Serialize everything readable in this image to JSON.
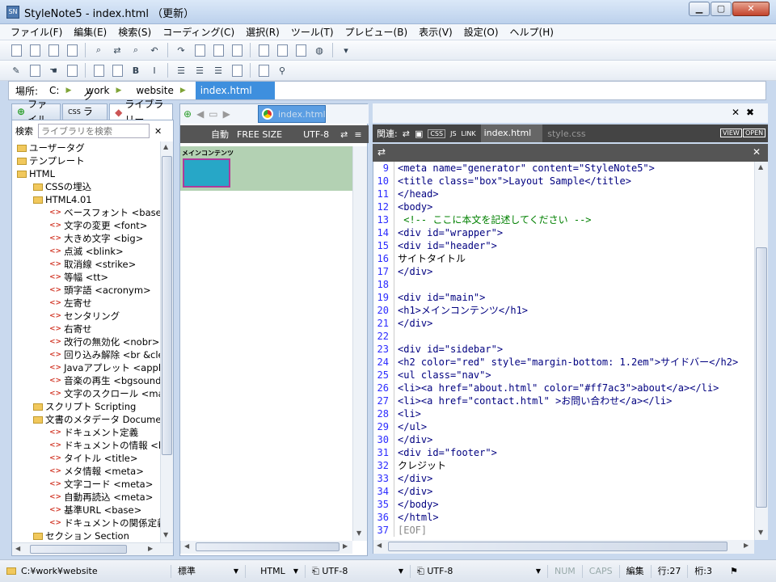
{
  "window": {
    "title": "StyleNote5 - index.html  （更新）"
  },
  "menu": [
    "ファイル(F)",
    "編集(E)",
    "検索(S)",
    "コーディング(C)",
    "選択(R)",
    "ツール(T)",
    "プレビュー(B)",
    "表示(V)",
    "設定(O)",
    "ヘルプ(H)"
  ],
  "toolbar1": [
    "new-file-icon",
    "open-file-icon",
    "save-icon",
    "save-all-icon",
    "find-icon",
    "replace-icon",
    "find-next-icon",
    "undo-icon",
    "redo-icon",
    "cut-icon",
    "copy-icon",
    "paste-icon",
    "color-palette-icon",
    "page-icon",
    "print-icon",
    "browser-icon",
    "browser-select-icon"
  ],
  "toolbar2": [
    "pencil-icon",
    "validate-icon",
    "hand-icon",
    "tag-icon",
    "html-icon",
    "css-icon",
    "bold-icon",
    "italic-icon",
    "align-left-icon",
    "align-center-icon",
    "align-right-icon",
    "image-icon",
    "table-icon",
    "link-icon"
  ],
  "path": {
    "label": "場所:",
    "crumbs": [
      "C:",
      "work",
      "website"
    ],
    "active": "index.html"
  },
  "left_tabs": [
    "ファイル",
    "クラス",
    "ライブラリー"
  ],
  "left_tab_prefix": {
    "class": "CSS"
  },
  "search": {
    "label": "検索",
    "placeholder": "ライブラリを検索"
  },
  "tree": [
    {
      "label": "ユーザータグ",
      "level": 0,
      "type": "folder"
    },
    {
      "label": "テンプレート",
      "level": 0,
      "type": "folder"
    },
    {
      "label": "HTML",
      "level": 0,
      "type": "folder"
    },
    {
      "label": "CSSの埋込",
      "level": 1,
      "type": "folder"
    },
    {
      "label": "HTML4.01",
      "level": 1,
      "type": "folder"
    },
    {
      "label": "ベースフォント <basefont>",
      "level": 2,
      "type": "tag"
    },
    {
      "label": "文字の変更 <font>",
      "level": 2,
      "type": "tag"
    },
    {
      "label": "大きめ文字 <big>",
      "level": 2,
      "type": "tag"
    },
    {
      "label": "点滅 <blink>",
      "level": 2,
      "type": "tag"
    },
    {
      "label": "取消線 <strike>",
      "level": 2,
      "type": "tag"
    },
    {
      "label": "等幅 <tt>",
      "level": 2,
      "type": "tag"
    },
    {
      "label": "頭字語 <acronym>",
      "level": 2,
      "type": "tag"
    },
    {
      "label": "左寄せ",
      "level": 2,
      "type": "tag"
    },
    {
      "label": "センタリング",
      "level": 2,
      "type": "tag"
    },
    {
      "label": "右寄せ",
      "level": 2,
      "type": "tag"
    },
    {
      "label": "改行の無効化 <nobr>",
      "level": 2,
      "type": "tag"
    },
    {
      "label": "回り込み解除 <br &clea",
      "level": 2,
      "type": "tag"
    },
    {
      "label": "Javaアプレット <applet>",
      "level": 2,
      "type": "tag"
    },
    {
      "label": "音楽の再生 <bgsound>",
      "level": 2,
      "type": "tag"
    },
    {
      "label": "文字のスクロール <marqu",
      "level": 2,
      "type": "tag"
    },
    {
      "label": "スクリプト Scripting",
      "level": 1,
      "type": "folder"
    },
    {
      "label": "文書のメタデータ Document",
      "level": 1,
      "type": "folder"
    },
    {
      "label": "ドキュメント定義",
      "level": 2,
      "type": "tag"
    },
    {
      "label": "ドキュメントの情報 <head",
      "level": 2,
      "type": "tag"
    },
    {
      "label": "タイトル <title>",
      "level": 2,
      "type": "tag"
    },
    {
      "label": "メタ情報 <meta>",
      "level": 2,
      "type": "tag"
    },
    {
      "label": "文字コード <meta>",
      "level": 2,
      "type": "tag"
    },
    {
      "label": "自動再読込 <meta>",
      "level": 2,
      "type": "tag"
    },
    {
      "label": "基準URL <base>",
      "level": 2,
      "type": "tag"
    },
    {
      "label": "ドキュメントの関係定義 <",
      "level": 2,
      "type": "tag"
    },
    {
      "label": "セクション Section",
      "level": 1,
      "type": "folder"
    }
  ],
  "tag_marker": "<>",
  "preview": {
    "tab": "index.html",
    "auto": "自動",
    "size": "FREE SIZE",
    "encoding": "UTF-8",
    "heading": "メインコンテンツ"
  },
  "editor_bar": {
    "related": "関連:",
    "tags": [
      "CSS",
      "JS",
      "LINK"
    ],
    "active": "index.html",
    "other": "style.css",
    "view": "VIEW",
    "open": "OPEN"
  },
  "code": [
    {
      "n": "9",
      "t": "<meta name=\"generator\" content=\"StyleNote5\">"
    },
    {
      "n": "10",
      "t": "<title class=\"box\">Layout Sample</title>"
    },
    {
      "n": "11",
      "t": "</head>"
    },
    {
      "n": "12",
      "t": "<body>"
    },
    {
      "n": "13",
      "t": " <!-- ここに本文を記述してください -->"
    },
    {
      "n": "14",
      "t": "<div id=\"wrapper\">"
    },
    {
      "n": "15",
      "t": "<div id=\"header\">"
    },
    {
      "n": "16",
      "t": "サイトタイトル"
    },
    {
      "n": "17",
      "t": "</div>"
    },
    {
      "n": "18",
      "t": ""
    },
    {
      "n": "19",
      "t": "<div id=\"main\">"
    },
    {
      "n": "20",
      "t": "<h1>メインコンテンツ</h1>"
    },
    {
      "n": "21",
      "t": "</div>"
    },
    {
      "n": "22",
      "t": ""
    },
    {
      "n": "23",
      "t": "<div id=\"sidebar\">"
    },
    {
      "n": "24",
      "t": "<h2 color=\"red\" style=\"margin-bottom: 1.2em\">サイドバー</h2>"
    },
    {
      "n": "25",
      "t": "<ul class=\"nav\">"
    },
    {
      "n": "26",
      "t": "<li><a href=\"about.html\" color=\"#ff7ac3\">about</a></li>"
    },
    {
      "n": "27",
      "t": "<li><a href=\"contact.html\" >お問い合わせ</a></li>"
    },
    {
      "n": "28",
      "t": "<li>"
    },
    {
      "n": "29",
      "t": "</ul>"
    },
    {
      "n": "30",
      "t": "</div>"
    },
    {
      "n": "31",
      "t": "<div id=\"footer\">"
    },
    {
      "n": "32",
      "t": "クレジット"
    },
    {
      "n": "33",
      "t": "</div>"
    },
    {
      "n": "34",
      "t": "</div>"
    },
    {
      "n": "35",
      "t": "</body>"
    },
    {
      "n": "36",
      "t": "</html>"
    },
    {
      "n": "37",
      "t": "[EOF]"
    }
  ],
  "status": {
    "path": "C:¥work¥website",
    "mode": "標準",
    "lang": "HTML",
    "enc1": "UTF-8",
    "enc2": "UTF-8",
    "num": "NUM",
    "caps": "CAPS",
    "edit": "編集",
    "row": "行:27",
    "col": "桁:3"
  },
  "colors": {
    "accent": "#3e8fde",
    "tag": "#000080",
    "attr_value": "#8b00ff",
    "comment": "#008000",
    "line_number": "#2b2bff"
  }
}
